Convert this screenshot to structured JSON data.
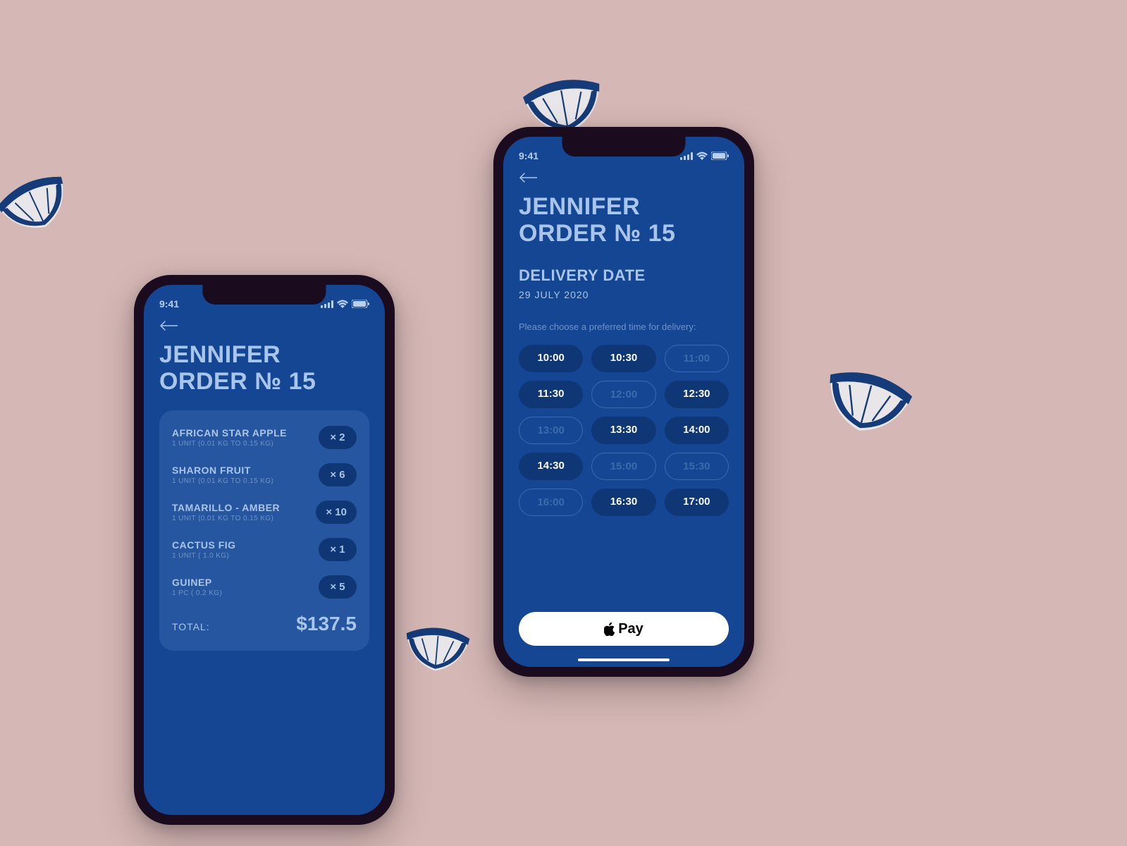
{
  "status": {
    "time": "9:41"
  },
  "left": {
    "title_line1": "JENNIFER",
    "title_line2": "ORDER № 15",
    "items": [
      {
        "name": "AFRICAN STAR APPLE",
        "desc": "1 UNIT (0.01 KG TO 0.15 KG)",
        "qty": "× 2"
      },
      {
        "name": "SHARON FRUIT",
        "desc": "1 UNIT (0.01 KG TO 0.15 KG)",
        "qty": "× 6"
      },
      {
        "name": "TAMARILLO - AMBER",
        "desc": "1 UNIT (0.01 KG TO 0.15 KG)",
        "qty": "× 10"
      },
      {
        "name": "CACTUS FIG",
        "desc": "1 UNIT ( 1.0 KG)",
        "qty": "× 1"
      },
      {
        "name": "GUINEP",
        "desc": "1 PC ( 0.2 KG)",
        "qty": "× 5"
      }
    ],
    "total_label": "TOTAL:",
    "total_amount": "$137.5"
  },
  "right": {
    "title_line1": "JENNIFER",
    "title_line2": "ORDER № 15",
    "delivery_title": "DELIVERY DATE",
    "delivery_date": "29 JULY 2020",
    "prompt": "Please choose a preferred time for delivery:",
    "times": [
      {
        "label": "10:00",
        "state": "available"
      },
      {
        "label": "10:30",
        "state": "available"
      },
      {
        "label": "11:00",
        "state": "disabled"
      },
      {
        "label": "11:30",
        "state": "available"
      },
      {
        "label": "12:00",
        "state": "disabled"
      },
      {
        "label": "12:30",
        "state": "available"
      },
      {
        "label": "13:00",
        "state": "disabled"
      },
      {
        "label": "13:30",
        "state": "available"
      },
      {
        "label": "14:00",
        "state": "available"
      },
      {
        "label": "14:30",
        "state": "available"
      },
      {
        "label": "15:00",
        "state": "disabled"
      },
      {
        "label": "15:30",
        "state": "disabled"
      },
      {
        "label": "16:00",
        "state": "disabled"
      },
      {
        "label": "16:30",
        "state": "available"
      },
      {
        "label": "17:00",
        "state": "available"
      }
    ],
    "pay_label": "Pay"
  }
}
